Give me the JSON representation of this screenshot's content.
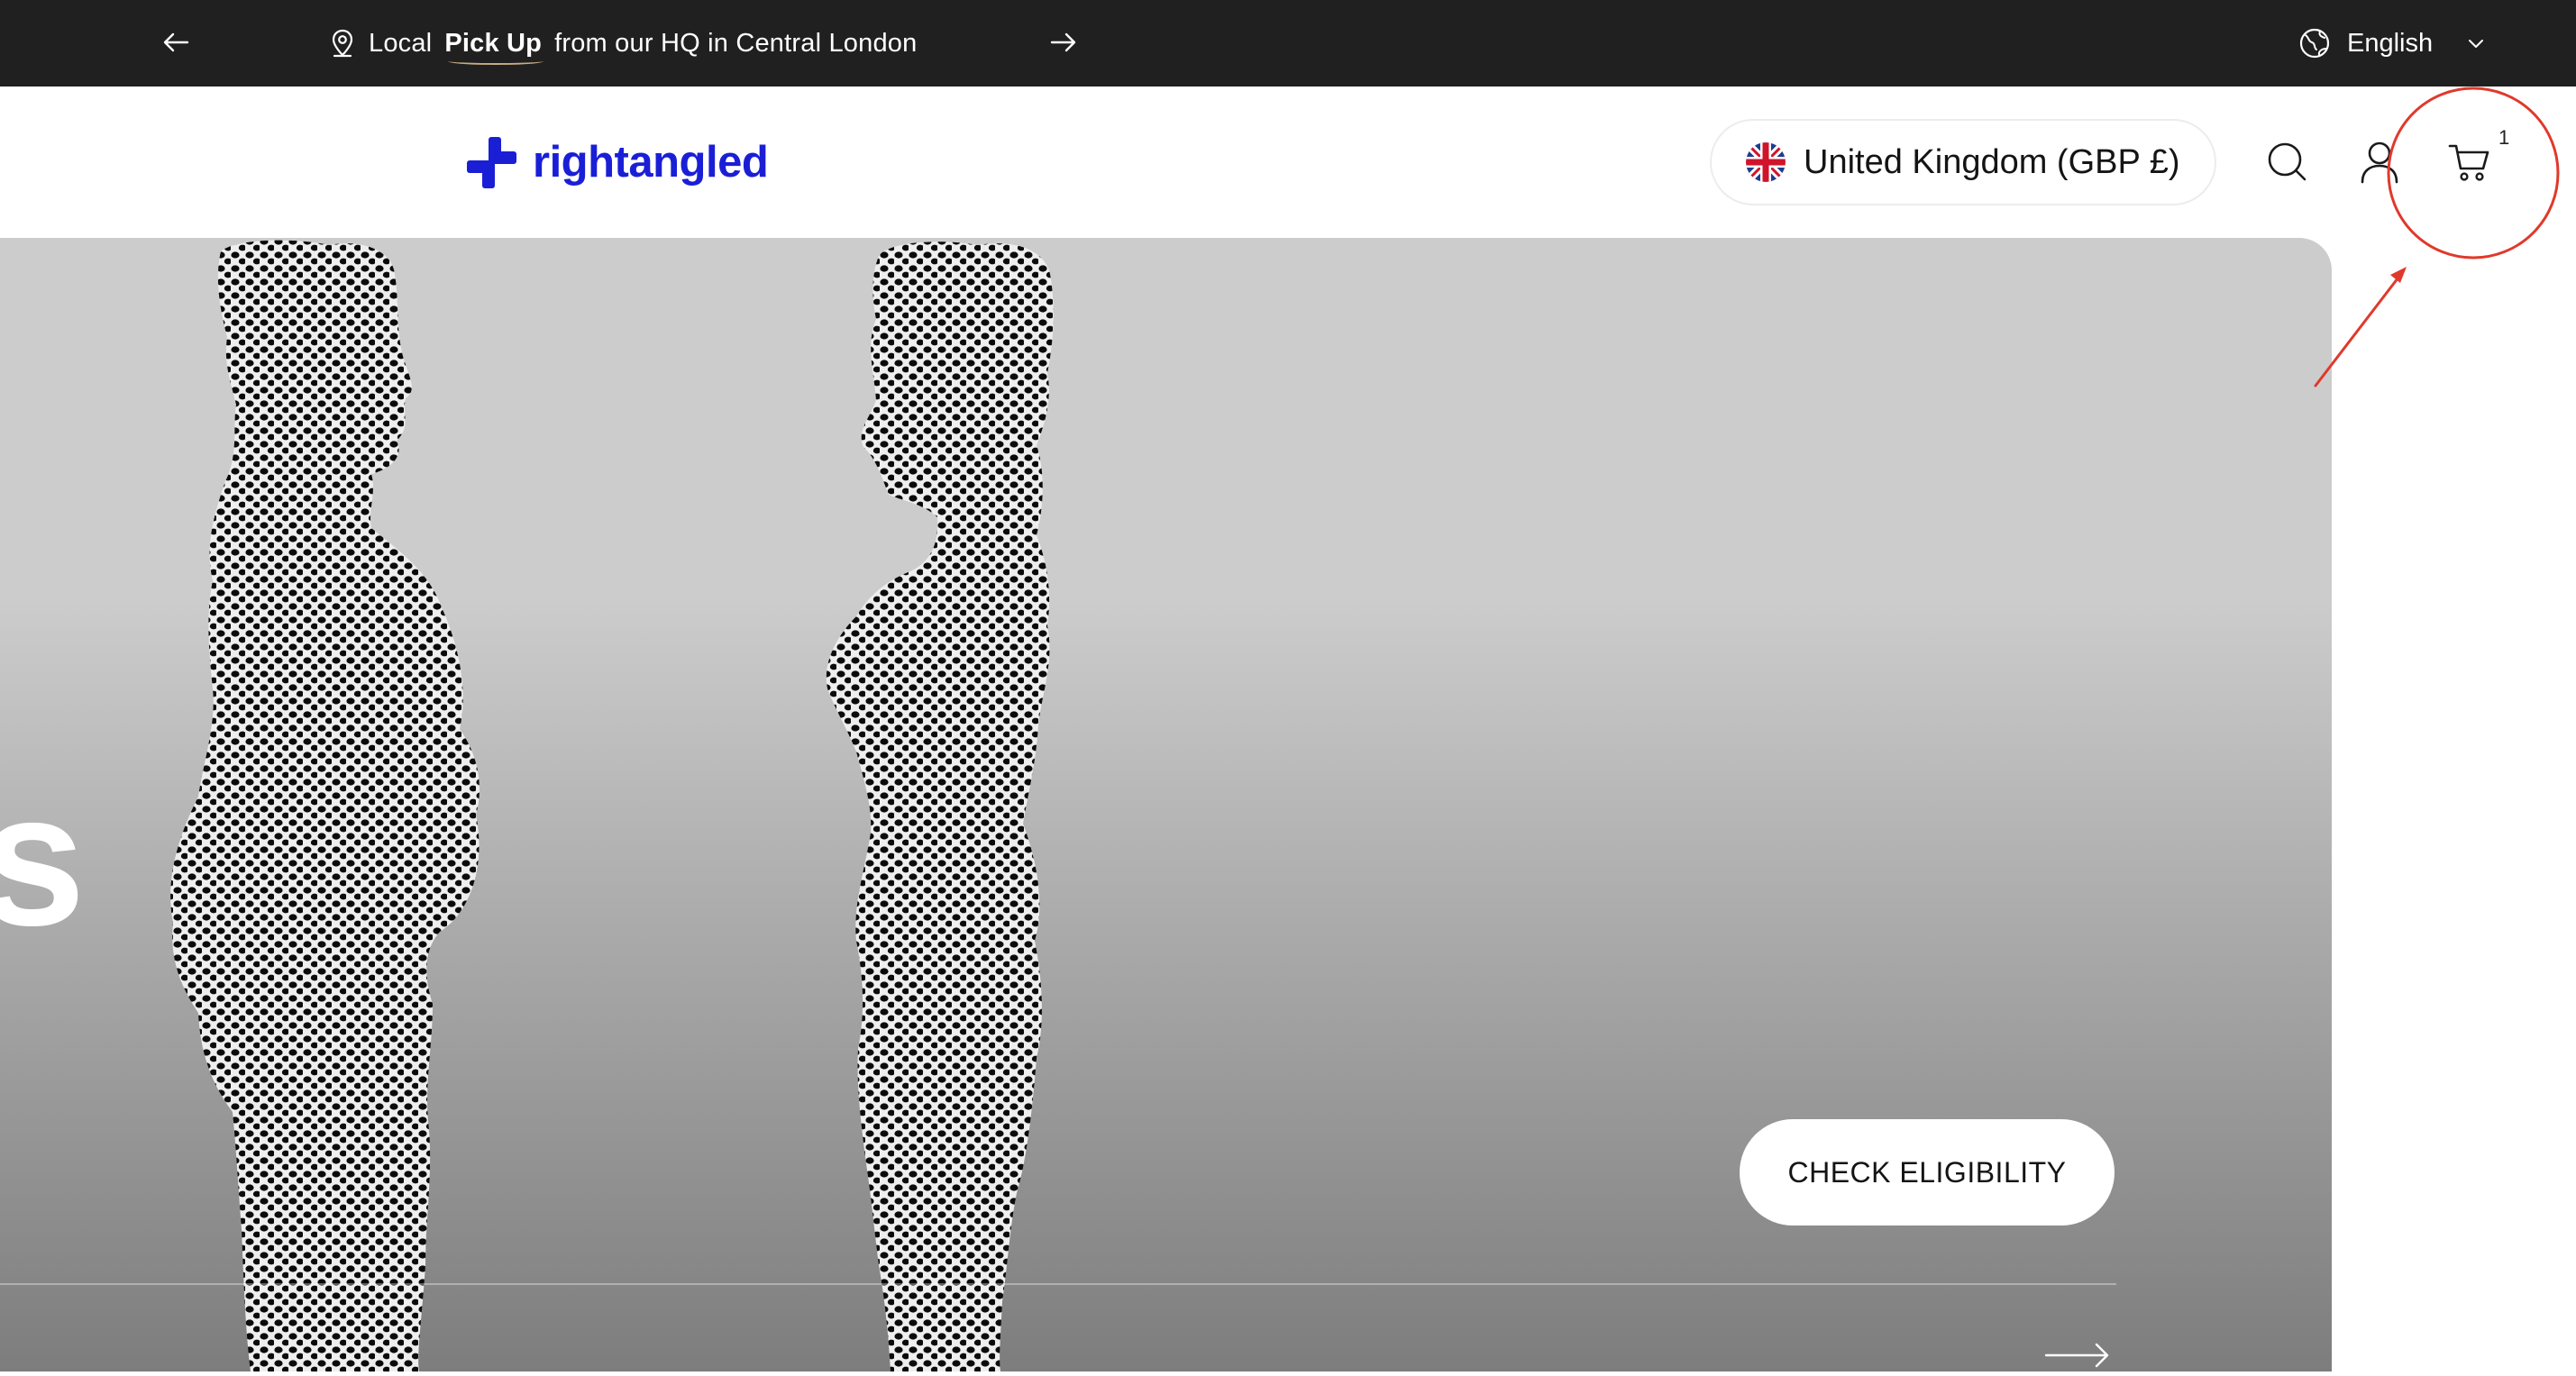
{
  "announcement": {
    "prefix": "Local",
    "highlight": "Pick Up",
    "suffix": "from our HQ in Central London",
    "prev_icon": "arrow-left-icon",
    "next_icon": "arrow-right-icon"
  },
  "language": {
    "label": "English",
    "icon": "globe-icon"
  },
  "header": {
    "logo_text": "rightangled",
    "region_label": "United Kingdom (GBP £)",
    "cart_count": "1"
  },
  "hero": {
    "heading_fragment": "s",
    "cta_label": "CHECK ELIGIBILITY"
  },
  "colors": {
    "announcement_bg": "#202020",
    "brand": "#1a1fd6",
    "annotation": "#e0392b"
  }
}
